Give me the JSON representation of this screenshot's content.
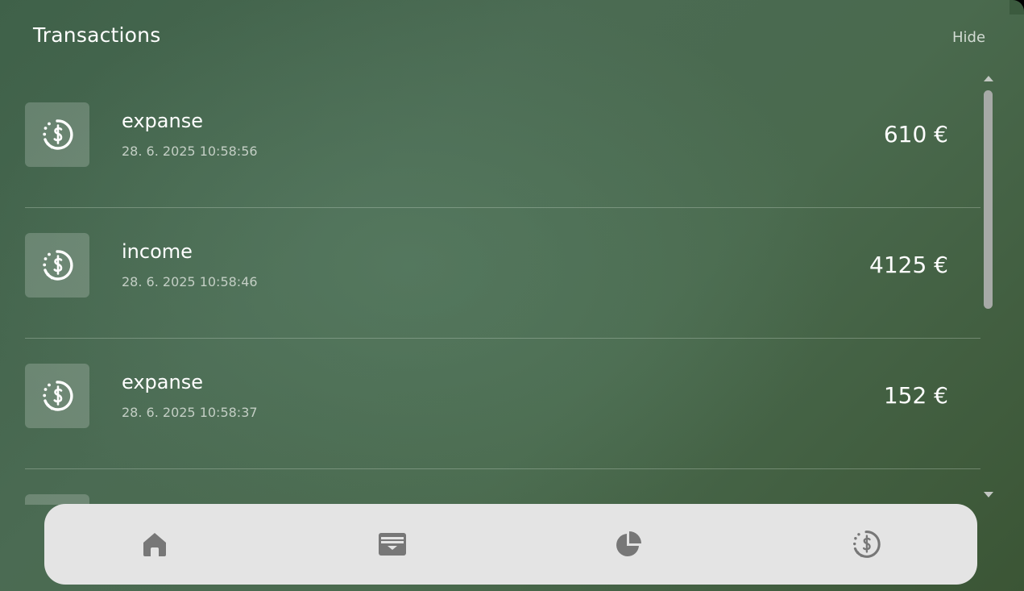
{
  "header": {
    "title": "Transactions",
    "hide_label": "Hide"
  },
  "transactions": [
    {
      "type": "expanse",
      "date": "28. 6. 2025 10:58:56",
      "amount": "610 €",
      "icon": "money-history-icon"
    },
    {
      "type": "income",
      "date": "28. 6. 2025 10:58:46",
      "amount": "4125 €",
      "icon": "money-history-icon"
    },
    {
      "type": "expanse",
      "date": "28. 6. 2025 10:58:37",
      "amount": "152 €",
      "icon": "money-history-icon"
    }
  ],
  "bottom_nav": {
    "items": [
      {
        "name": "home",
        "icon": "home-icon"
      },
      {
        "name": "wallet",
        "icon": "wallet-icon"
      },
      {
        "name": "stats",
        "icon": "pie-chart-icon"
      },
      {
        "name": "transactions",
        "icon": "money-history-icon"
      }
    ]
  },
  "colors": {
    "nav_background": "#e4e4e4",
    "nav_icon": "#777777",
    "background_dark": "#3b5535",
    "background_mid": "#4b6b53"
  }
}
